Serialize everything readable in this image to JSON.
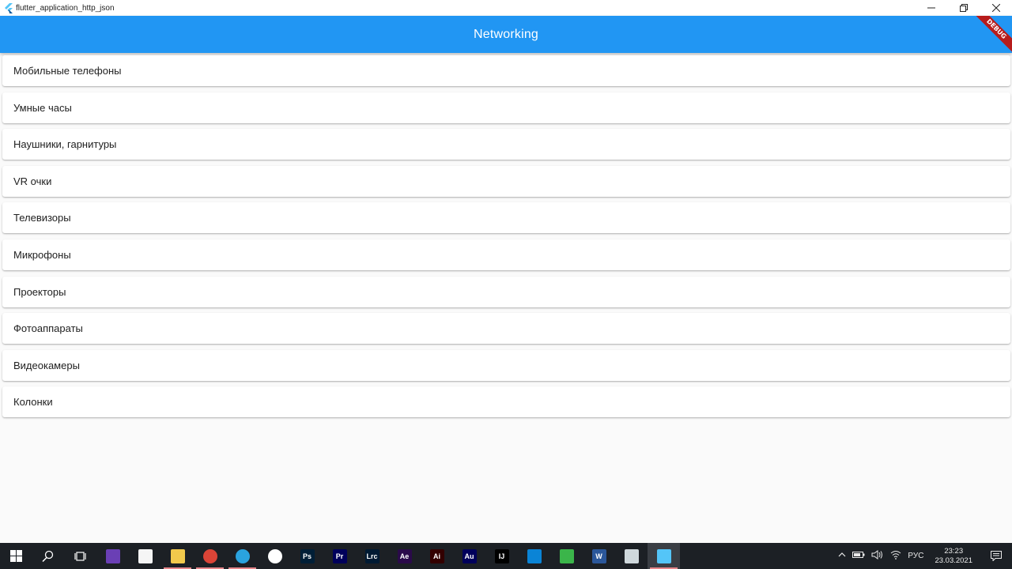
{
  "window": {
    "title": "flutter_application_http_json",
    "controls": {
      "minimize": "—",
      "restore": "❐",
      "close": "✕"
    }
  },
  "appbar": {
    "title": "Networking",
    "banner": "DEBUG",
    "color": "#2196f3"
  },
  "categories": [
    {
      "label": "Мобильные телефоны"
    },
    {
      "label": "Умные часы"
    },
    {
      "label": "Наушники, гарнитуры"
    },
    {
      "label": "VR очки"
    },
    {
      "label": "Телевизоры"
    },
    {
      "label": "Микрофоны"
    },
    {
      "label": "Проекторы"
    },
    {
      "label": "Фотоаппараты"
    },
    {
      "label": "Видеокамеры"
    },
    {
      "label": "Колонки"
    }
  ],
  "taskbar": {
    "apps": [
      {
        "name": "visual-studio-icon",
        "text": "",
        "color": "#6a3fb5"
      },
      {
        "name": "store-icon",
        "text": "",
        "color": "#f5f5f5"
      },
      {
        "name": "file-explorer-icon",
        "text": "",
        "color": "#f2c94c"
      },
      {
        "name": "chrome-icon",
        "text": "",
        "color": "#db4437"
      },
      {
        "name": "telegram-icon",
        "text": "",
        "color": "#2aa3df"
      },
      {
        "name": "app-w-icon",
        "text": "",
        "color": "#ffffff"
      },
      {
        "name": "photoshop-icon",
        "text": "Ps",
        "color": "#001e36"
      },
      {
        "name": "premiere-icon",
        "text": "Pr",
        "color": "#00005b"
      },
      {
        "name": "lightroom-icon",
        "text": "Lrc",
        "color": "#001a33"
      },
      {
        "name": "after-effects-icon",
        "text": "Ae",
        "color": "#2a0a4a"
      },
      {
        "name": "illustrator-icon",
        "text": "Ai",
        "color": "#330000"
      },
      {
        "name": "audition-icon",
        "text": "Au",
        "color": "#00005b"
      },
      {
        "name": "intellij-icon",
        "text": "IJ",
        "color": "#000000"
      },
      {
        "name": "vscode-icon",
        "text": "",
        "color": "#0a84d6"
      },
      {
        "name": "gitlab-icon",
        "text": "",
        "color": "#3bb54a"
      },
      {
        "name": "word-icon",
        "text": "W",
        "color": "#2b579a"
      },
      {
        "name": "image-viewer-icon",
        "text": "",
        "color": "#cfd8dc"
      },
      {
        "name": "flutter-icon",
        "text": "",
        "color": "#54c5f8"
      }
    ],
    "tray": {
      "language": "РУС",
      "time": "23:23",
      "date": "23.03.2021"
    }
  }
}
